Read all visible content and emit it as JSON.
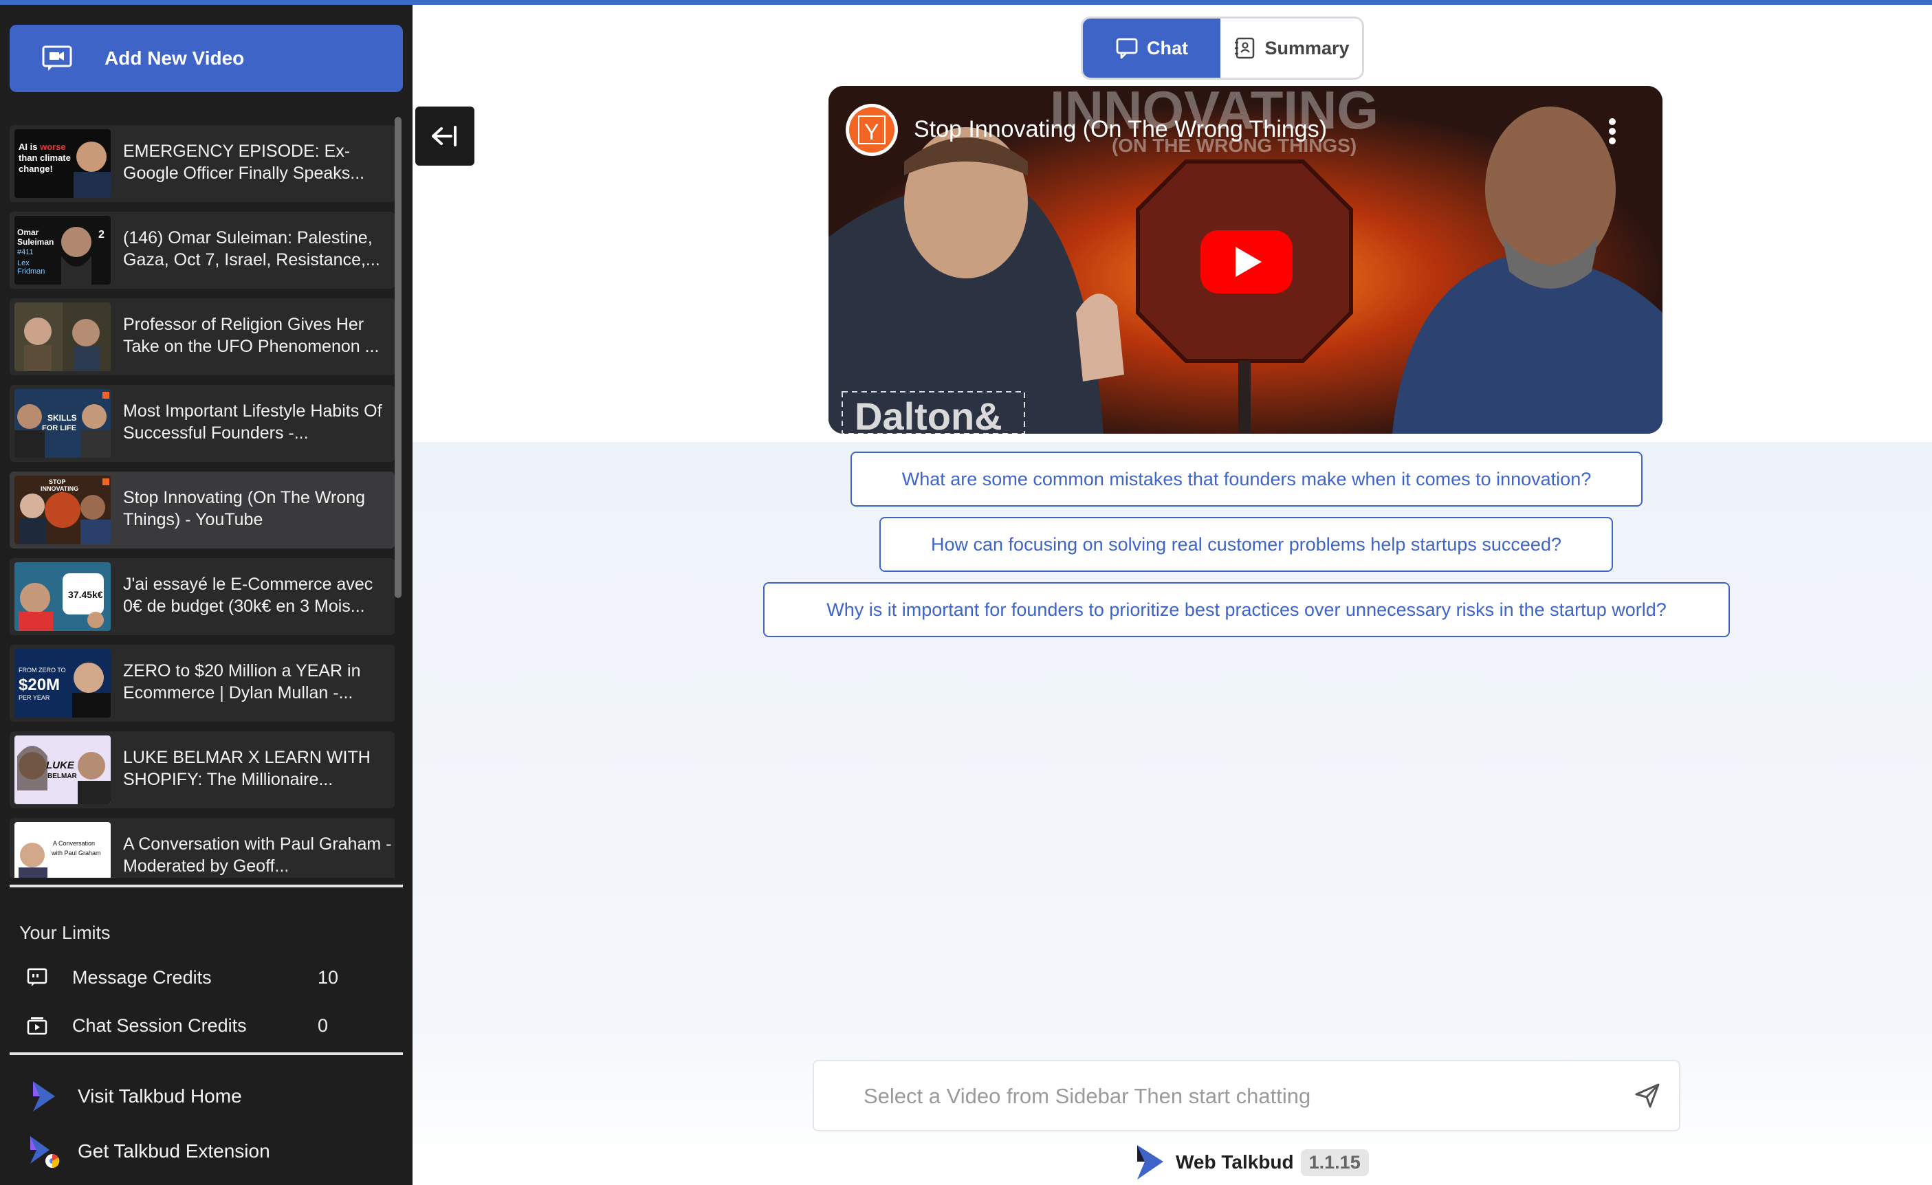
{
  "sidebar": {
    "add_button_label": "Add New Video",
    "videos": [
      {
        "title": "EMERGENCY EPISODE: Ex-Google Officer Finally Speaks...",
        "thumb_text": "AI is worse than climate change!"
      },
      {
        "title": "(146) Omar Suleiman: Palestine, Gaza, Oct 7, Israel, Resistance,...",
        "thumb_text": "Omar Suleiman #411 Lex Fridman"
      },
      {
        "title": "Professor of Religion Gives Her Take on the UFO Phenomenon ...",
        "thumb_text": ""
      },
      {
        "title": "Most Important Lifestyle Habits Of Successful Founders -...",
        "thumb_text": "SKILLS FOR LIFE"
      },
      {
        "title": "Stop Innovating (On The Wrong Things) - YouTube",
        "thumb_text": "STOP INNOVATING"
      },
      {
        "title": "J'ai essayé le E-Commerce avec 0€ de budget (30k€ en 3 Mois...",
        "thumb_text": "37.45k€"
      },
      {
        "title": "ZERO to $20 Million a YEAR in Ecommerce | Dylan Mullan -...",
        "thumb_text": "$20M"
      },
      {
        "title": "LUKE BELMAR X LEARN WITH SHOPIFY: The Millionaire...",
        "thumb_text": "LUKE BELMAR"
      },
      {
        "title": "A Conversation with Paul Graham - Moderated by Geoff...",
        "thumb_text": "A Conversation with Paul Graham"
      }
    ],
    "selected_index": 4,
    "limits": {
      "title": "Your Limits",
      "message_credits_label": "Message Credits",
      "message_credits_value": "10",
      "chat_session_label": "Chat Session Credits",
      "chat_session_value": "0"
    },
    "links": {
      "home": "Visit Talkbud Home",
      "extension": "Get Talkbud Extension"
    }
  },
  "main": {
    "tabs": {
      "chat": "Chat",
      "summary": "Summary"
    },
    "video": {
      "title": "Stop Innovating (On The Wrong Things)",
      "channel_initial": "Y",
      "overlay_text": "INNOVATING",
      "overlay_subtext": "(ON THE WRONG THINGS)",
      "watermark": "Dalton&"
    },
    "suggestions": [
      "What are some common mistakes that founders make when it comes to innovation?",
      "How can focusing on solving real customer problems help startups succeed?",
      "Why is it important for founders to prioritize best practices over unnecessary risks in the startup world?"
    ],
    "chat_input": {
      "placeholder": "Select a Video from Sidebar Then start chatting",
      "value": ""
    }
  },
  "footer": {
    "brand": "Web Talkbud",
    "version": "1.1.15"
  },
  "colors": {
    "accent": "#3e64c7",
    "sidebar_bg": "#1e1e1e",
    "youtube_red": "#ff0000"
  }
}
